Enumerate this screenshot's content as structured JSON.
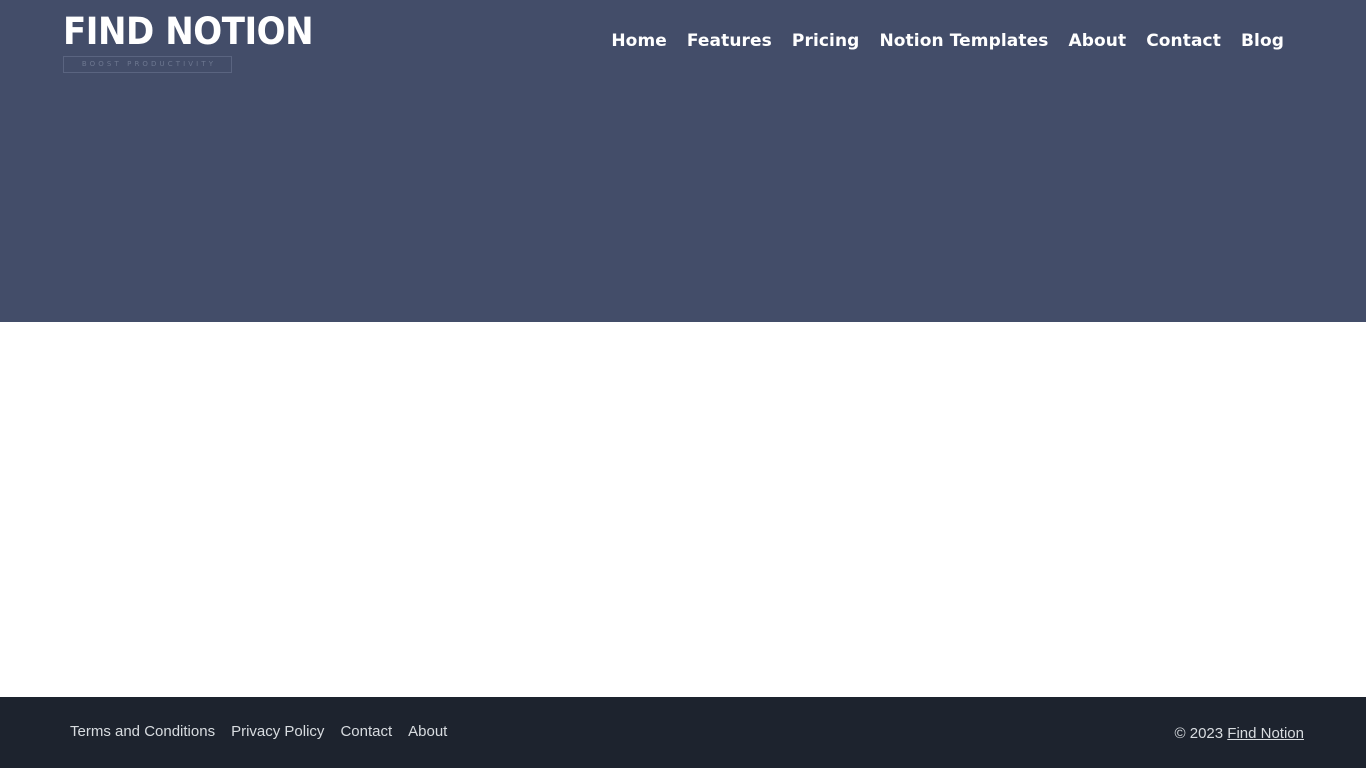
{
  "site": {
    "name": "Find Notion"
  },
  "header": {
    "logo": {
      "word": "FIND NOTION",
      "tagline": "BOOST PRODUCTIVITY"
    },
    "nav": [
      {
        "label": "Home"
      },
      {
        "label": "Features"
      },
      {
        "label": "Pricing"
      },
      {
        "label": "Notion Templates"
      },
      {
        "label": "About"
      },
      {
        "label": "Contact"
      },
      {
        "label": "Blog"
      }
    ]
  },
  "footer": {
    "links": [
      {
        "label": "Terms and Conditions"
      },
      {
        "label": "Privacy Policy"
      },
      {
        "label": "Contact"
      },
      {
        "label": "About"
      }
    ],
    "copyright_prefix": "© 2023 ",
    "copyright_link": "Find Notion"
  },
  "colors": {
    "hero_band": "#434d69",
    "footer_band": "#1d232e",
    "main_background": "#ffffff",
    "nav_text": "#ffffff",
    "footer_text": "#d8dce0",
    "tagline_text": "#6d7790",
    "tagline_border": "#5a6480"
  }
}
